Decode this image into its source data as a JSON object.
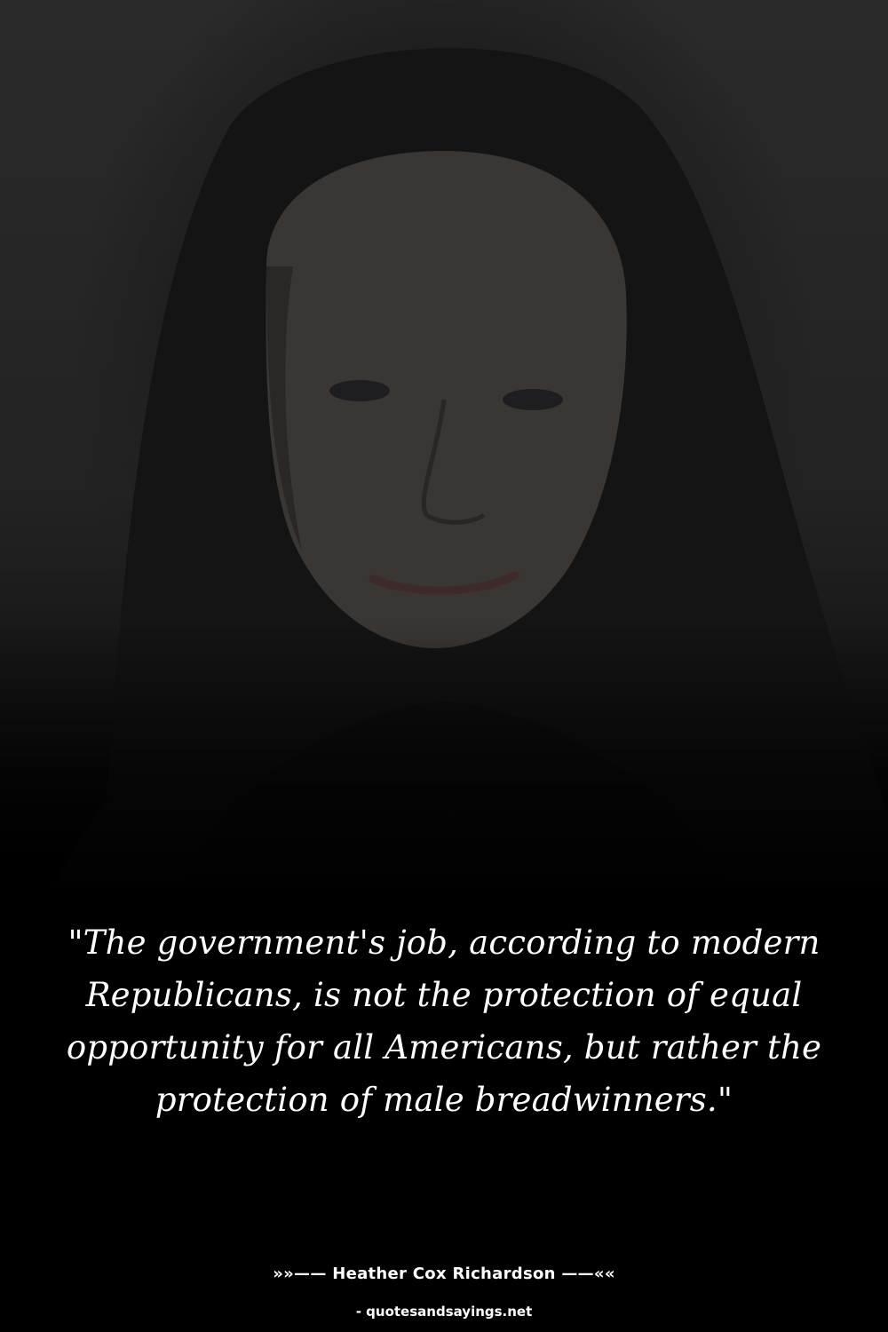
{
  "quote": {
    "text": "\"The government's job, according to modern Republicans, is not the protection of equal opportunity for all Americans, but rather the protection of male breadwinners.\""
  },
  "attribution": {
    "author_line": "»»—— Heather Cox Richardson ——««"
  },
  "watermark": {
    "site": "- quotesandsayings.net"
  },
  "colors": {
    "background": "#000000",
    "text": "#ffffff"
  }
}
